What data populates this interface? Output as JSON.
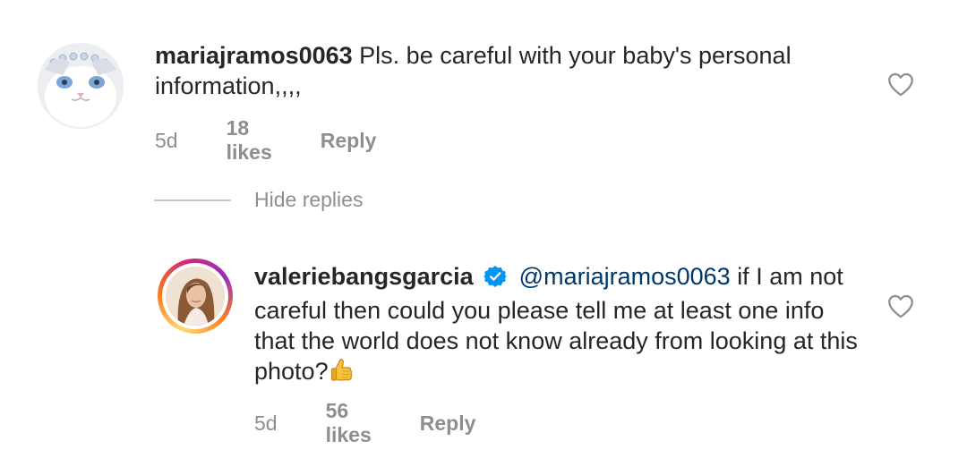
{
  "comments": [
    {
      "username": "mariajramos0063",
      "text": "Pls. be careful with your baby's  personal information,,,,",
      "time": "5d",
      "likes": "18 likes",
      "reply_label": "Reply"
    },
    {
      "username": "valeriebangsgarcia",
      "mention": "@mariajramos0063",
      "text": "if I am not careful then could you please tell me at least one info that the world does not know already from looking at this photo?",
      "time": "5d",
      "likes": "56 likes",
      "reply_label": "Reply"
    }
  ],
  "thread": {
    "hide_replies_label": "Hide replies"
  },
  "colors": {
    "text": "#262626",
    "meta": "#8e8e8e",
    "mention": "#00376b",
    "verified": "#0095f6"
  },
  "icons": {
    "like": "heart-outline-icon",
    "verified": "verified-badge-icon",
    "emoji": "thumbs-up-emoji"
  }
}
